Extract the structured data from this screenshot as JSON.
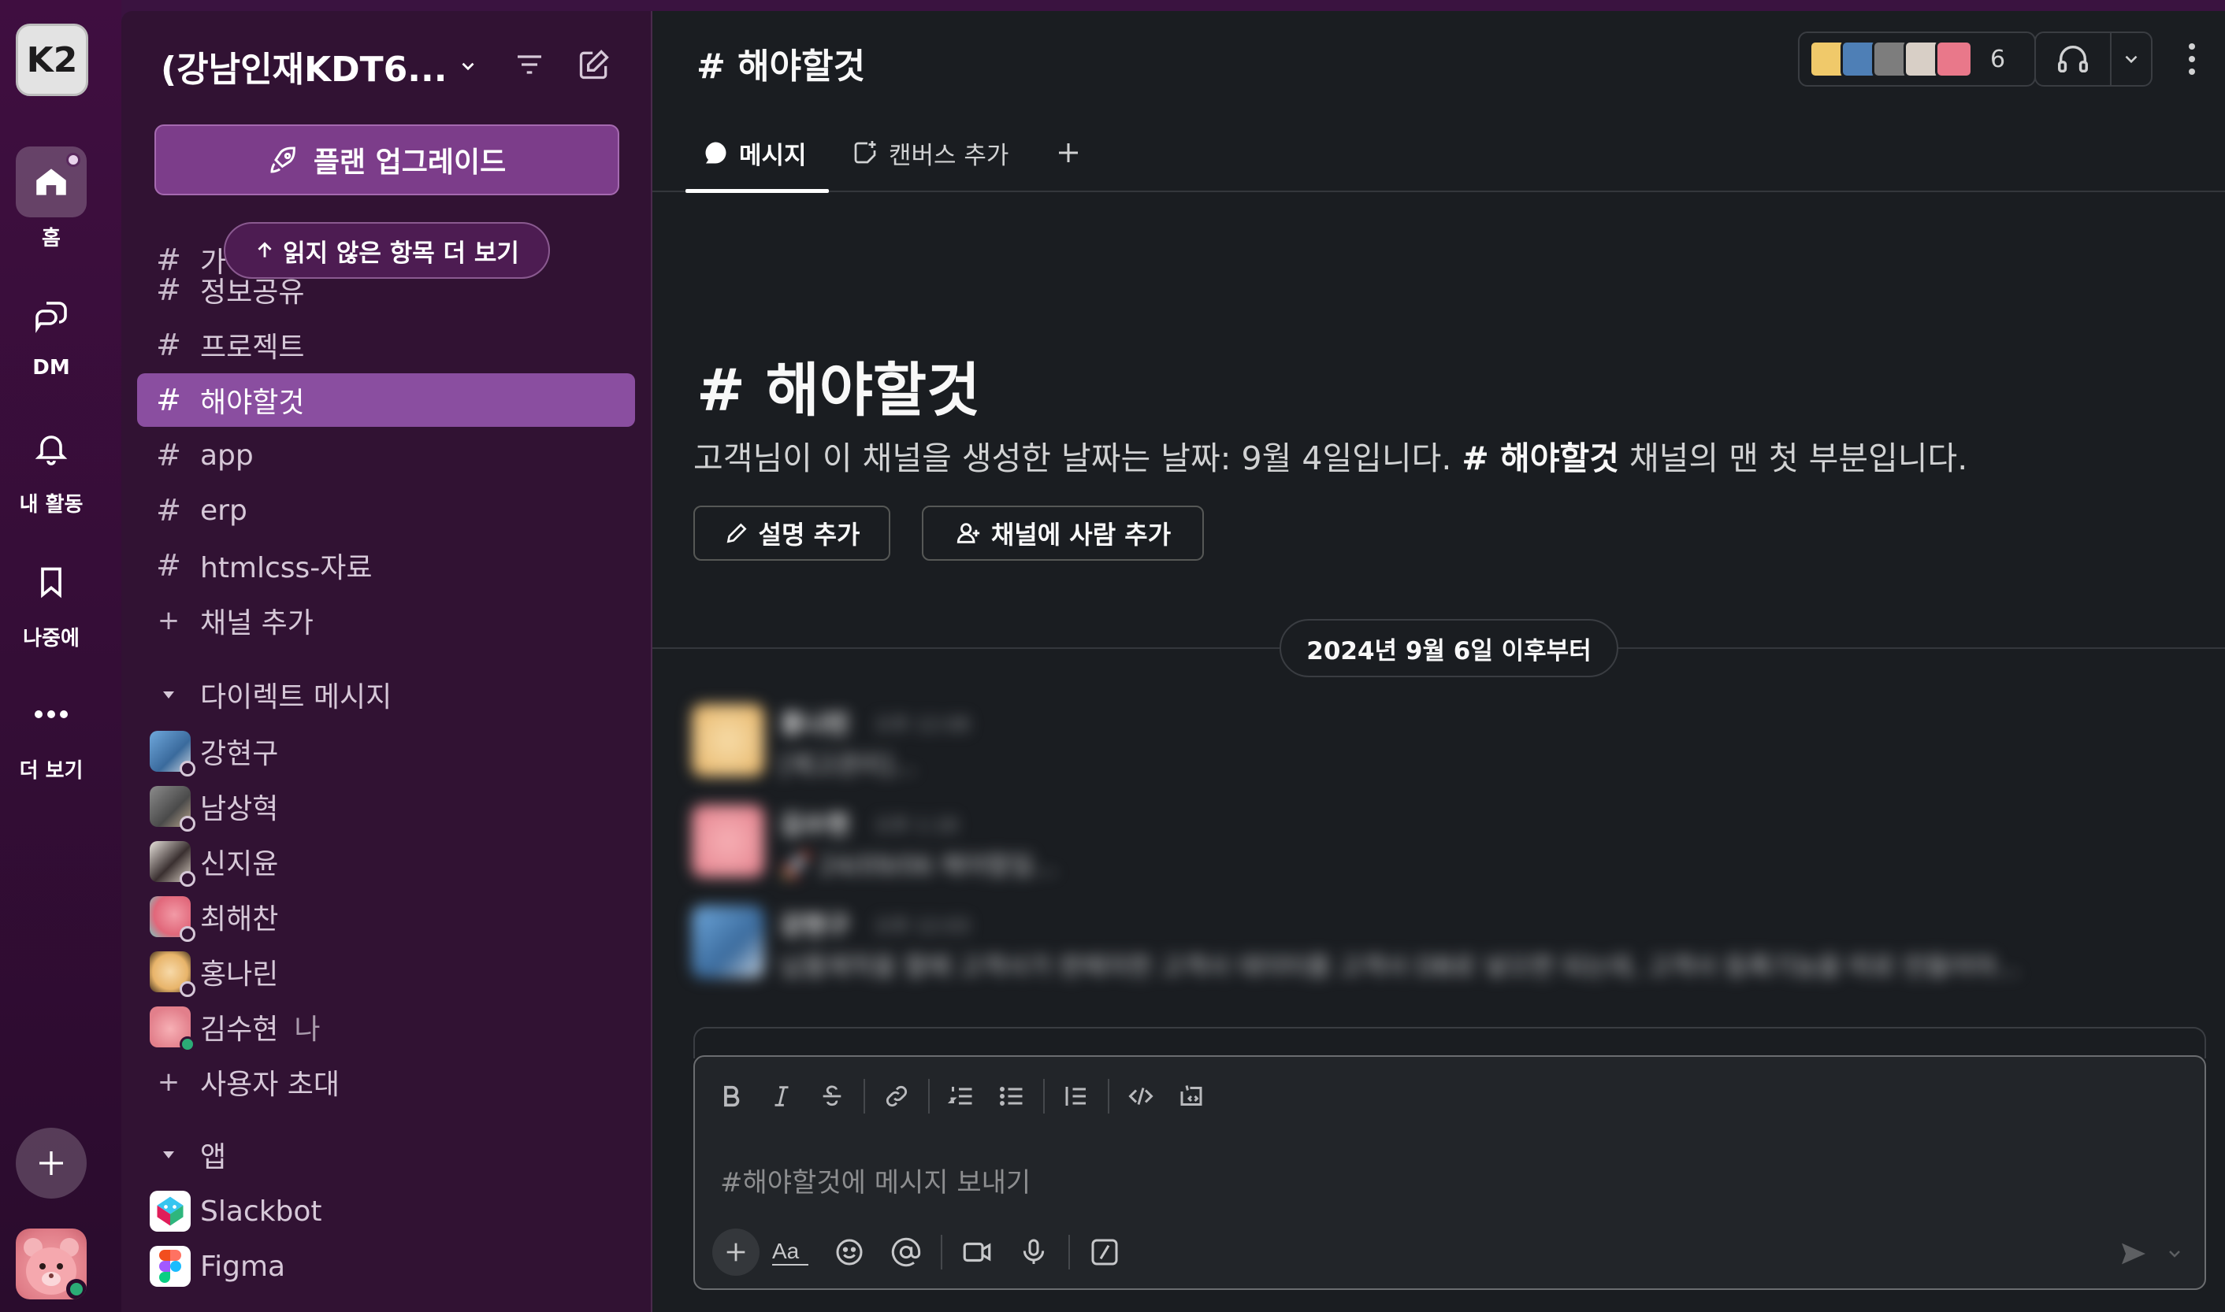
{
  "rail": {
    "workspace_badge": "K2",
    "items": [
      {
        "label": "홈",
        "icon": "home-icon"
      },
      {
        "label": "DM",
        "icon": "dm-icon"
      },
      {
        "label": "내 활동",
        "icon": "bell-icon"
      },
      {
        "label": "나중에",
        "icon": "bookmark-icon"
      },
      {
        "label": "더 보기",
        "icon": "more-icon"
      }
    ]
  },
  "sidebar": {
    "workspace_name": "(강남인재KDT6...",
    "upgrade_label": "플랜 업그레이드",
    "unread_pill": "읽지 않은 항목 더 보기",
    "channels": [
      {
        "name": "가"
      },
      {
        "name": "정보공유"
      },
      {
        "name": "프로젝트"
      },
      {
        "name": "해야할것"
      },
      {
        "name": "app"
      },
      {
        "name": "erp"
      },
      {
        "name": "htmlcss-자료"
      }
    ],
    "add_channel": "채널 추가",
    "dm_section": "다이렉트 메시지",
    "dms": [
      {
        "name": "강현구"
      },
      {
        "name": "남상혁"
      },
      {
        "name": "신지윤"
      },
      {
        "name": "최해찬"
      },
      {
        "name": "홍나린"
      },
      {
        "name": "김수현",
        "me": "나"
      }
    ],
    "invite_user": "사용자 초대",
    "apps_section": "앱",
    "apps": [
      {
        "name": "Slackbot"
      },
      {
        "name": "Figma"
      }
    ]
  },
  "header": {
    "channel_title": "# 해야할것",
    "member_count": "6",
    "tabs": [
      {
        "label": "메시지"
      },
      {
        "label": "캔버스 추가"
      }
    ]
  },
  "intro": {
    "title": "# 해야할것",
    "desc_prefix": "고객님이 이 채널을 생성한 날짜는 날짜: 9월 4일입니다. ",
    "desc_channel": "# 해야할것",
    "desc_suffix": " 채널의 맨 첫 부분입니다.",
    "add_description": "설명 추가",
    "add_people": "채널에 사람 추가"
  },
  "date_divider": "2024년 9월 6일 이후부터",
  "messages": [
    {
      "name": "홍나린",
      "time": "오후 12:08",
      "text": "[제고관리]..."
    },
    {
      "name": "김수현",
      "time": "오후 1:18",
      "text": "🚀 24/09/06 해야할일..."
    },
    {
      "name": "강현구",
      "time": "오후 12:03",
      "text": "납품제작을 할때 고객사가 판매자한 고객사 데이터를 고객사 DB로 넣으면 되는데, 고객사 등록기능을 따로 만들어야..."
    }
  ],
  "composer": {
    "placeholder": "#해야할것에 메시지 보내기"
  },
  "colors": {
    "rail_bg": "#3f0e40",
    "sidebar_bg": "#311233",
    "active_channel": "#8a4ea0",
    "upgrade_button": "#7c3d8a",
    "main_bg": "#1a1d21",
    "online": "#2bac76"
  }
}
